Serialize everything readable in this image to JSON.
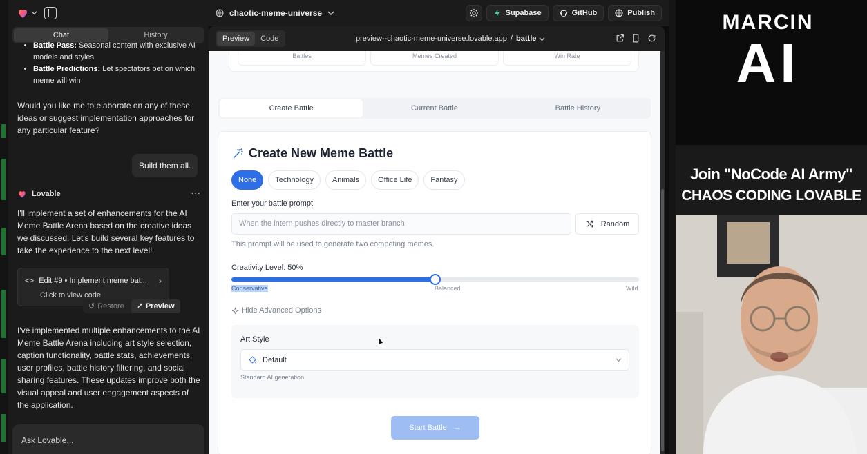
{
  "topbar": {
    "project_name": "chaotic-meme-universe",
    "supabase_label": "Supabase",
    "github_label": "GitHub",
    "publish_label": "Publish"
  },
  "chat": {
    "tabs": [
      "Chat",
      "History"
    ],
    "bullets": [
      {
        "title": "Battle Pass:",
        "text": " Seasonal content with exclusive AI models and styles"
      },
      {
        "title": "Battle Predictions:",
        "text": " Let spectators bet on which meme will win"
      }
    ],
    "question": "Would you like me to elaborate on any of these ideas or suggest implementation approaches for any particular feature?",
    "user_message": "Build them all.",
    "bot_name": "Lovable",
    "bot_intro": "I'll implement a set of enhancements for the AI Meme Battle Arena based on the creative ideas we discussed. Let's build several key features to take the experience to the next level!",
    "edit_title": "Edit #9 • Implement meme bat...",
    "edit_sub": "Click to view code",
    "restore_label": "Restore",
    "preview_label": "Preview",
    "bot_summary": "I've implemented multiple enhancements to the AI Meme Battle Arena including art style selection, caption functionality, battle stats, achievements, user profiles, battle history filtering, and social sharing features. These updates improve both the visual appeal and user engagement aspects of the application.",
    "input_placeholder": "Ask Lovable..."
  },
  "preview": {
    "modes": [
      "Preview",
      "Code"
    ],
    "url_host": "preview--chaotic-meme-universe.lovable.app",
    "url_sep": " / ",
    "url_path": "battle"
  },
  "app": {
    "stats": [
      "Battles",
      "Memes Created",
      "Win Rate"
    ],
    "tabs": [
      "Create Battle",
      "Current Battle",
      "Battle History"
    ],
    "title": "Create New Meme Battle",
    "chips": [
      "None",
      "Technology",
      "Animals",
      "Office Life",
      "Fantasy"
    ],
    "prompt_label": "Enter your battle prompt:",
    "prompt_placeholder": "When the intern pushes directly to master branch",
    "random_label": "Random",
    "prompt_hint": "This prompt will be used to generate two competing memes.",
    "creativity_label": "Creativity Level: 50%",
    "creativity_value": 0.5,
    "slider_labels": [
      "Conservative",
      "Balanced",
      "Wild"
    ],
    "advanced_toggle": "Hide Advanced Options",
    "art_style_label": "Art Style",
    "art_style_value": "Default",
    "art_style_desc": "Standard AI generation",
    "start_label": "Start Battle"
  },
  "overlay": {
    "brand_top": "MARCIN",
    "brand_big": "AI",
    "banner_line1": "Join \"NoCode AI Army\"",
    "banner_line2": "CHAOS CODING LOVABLE"
  },
  "colors": {
    "accent": "#2e6fe6",
    "dark_bg": "#1b1b1b",
    "supabase_green": "#3ecf8e"
  }
}
